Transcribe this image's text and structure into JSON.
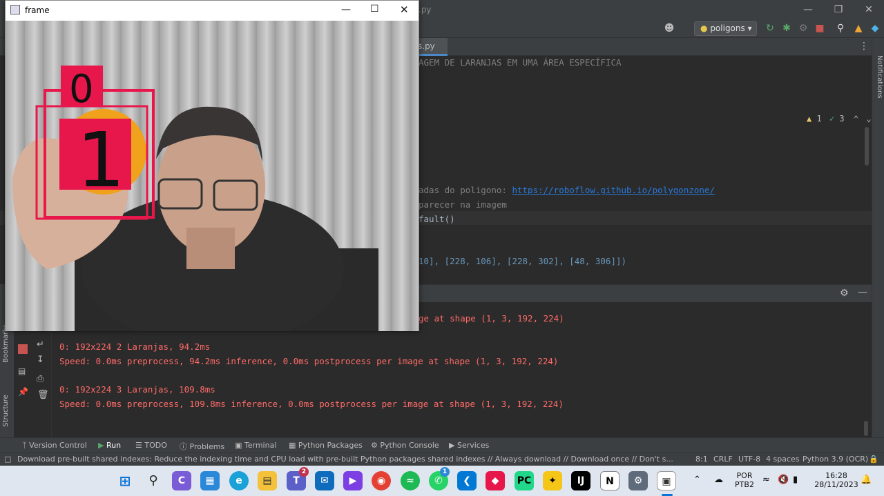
{
  "ide": {
    "tab_partial_top": ".py",
    "run_config": "poligons",
    "editor_tab": "s.py",
    "code_lines": [
      {
        "kind": "comment",
        "text": "AGEM DE LARANJAS EM UMA ÁREA ESPECÍFICA"
      },
      {
        "kind": "comment",
        "text": "adas do poligono: "
      },
      {
        "kind": "link",
        "text": "https://roboflow.github.io/polygonzone/"
      },
      {
        "kind": "comment",
        "text": "parecer na imagem"
      },
      {
        "kind": "code",
        "text": "fault()"
      },
      {
        "kind": "code",
        "text": "10], [228, 106], [228, 302], [48, 306]])"
      }
    ],
    "inspections": {
      "warnings": "1",
      "checks": "3"
    },
    "notifications_label": "Notifications",
    "side_labels": [
      "Structure",
      "Bookmarks"
    ]
  },
  "console": {
    "lines": [
      "ge at shape (1, 3, 192, 224)",
      "0: 192x224 2 Laranjas, 94.2ms",
      "Speed: 0.0ms preprocess, 94.2ms inference, 0.0ms postprocess per image at shape (1, 3, 192, 224)",
      "0: 192x224 3 Laranjas, 109.8ms",
      "Speed: 0.0ms preprocess, 109.8ms inference, 0.0ms postprocess per image at shape (1, 3, 192, 224)"
    ]
  },
  "toolwindows": [
    "Version Control",
    "Run",
    "TODO",
    "Problems",
    "Terminal",
    "Python Packages",
    "Python Console",
    "Services"
  ],
  "status": {
    "message": "Download pre-built shared indexes: Reduce the indexing time and CPU load with pre-built Python packages shared indexes // Always download // Download once // Don't s... (44 minutes ago)",
    "position": "8:1",
    "line_sep": "CRLF",
    "encoding": "UTF-8",
    "indent": "4 spaces",
    "interpreter": "Python 3.9 (OCR)"
  },
  "frame": {
    "title": "frame",
    "labels": [
      "0",
      "1"
    ]
  },
  "taskbar": {
    "teams_badge": "2",
    "whatsapp_badge": "1",
    "language": "POR",
    "keyboard": "PTB2",
    "time": "16:28",
    "date": "28/11/2023"
  },
  "colors": {
    "accent": "#e8174b",
    "console_red": "#ff6b68",
    "link": "#287bde"
  }
}
